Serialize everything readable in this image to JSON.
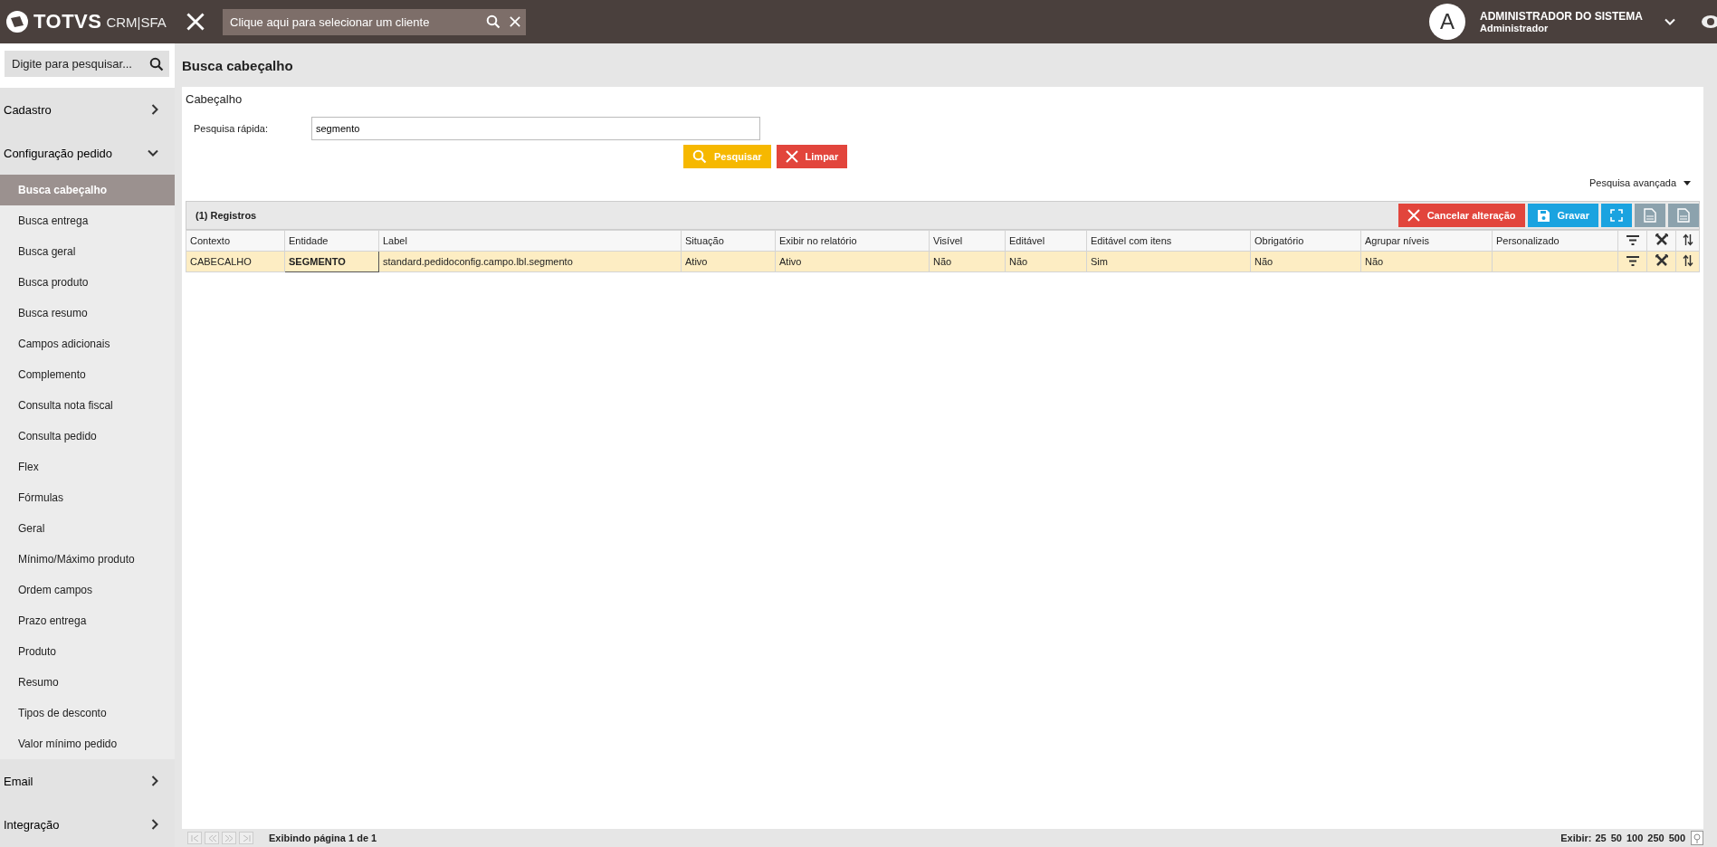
{
  "topbar": {
    "brand": "TOTVS",
    "product": "CRM|SFA",
    "client_search": {
      "placeholder": "Clique aqui para selecionar um cliente"
    },
    "user": {
      "initial": "A",
      "name": "ADMINISTRADOR DO SISTEMA",
      "role": "Administrador"
    }
  },
  "sidebar": {
    "search": {
      "placeholder": "Digite para pesquisar..."
    },
    "items": [
      {
        "label": "Cadastro",
        "expanded": false
      },
      {
        "label": "Configuração pedido",
        "expanded": true,
        "children": [
          {
            "label": "Busca cabeçalho",
            "selected": true
          },
          {
            "label": "Busca entrega",
            "selected": false
          },
          {
            "label": "Busca geral",
            "selected": false
          },
          {
            "label": "Busca produto",
            "selected": false
          },
          {
            "label": "Busca resumo",
            "selected": false
          },
          {
            "label": "Campos adicionais",
            "selected": false
          },
          {
            "label": "Complemento",
            "selected": false
          },
          {
            "label": "Consulta nota fiscal",
            "selected": false
          },
          {
            "label": "Consulta pedido",
            "selected": false
          },
          {
            "label": "Flex",
            "selected": false
          },
          {
            "label": "Fórmulas",
            "selected": false
          },
          {
            "label": "Geral",
            "selected": false
          },
          {
            "label": "Mínimo/Máximo produto",
            "selected": false
          },
          {
            "label": "Ordem campos",
            "selected": false
          },
          {
            "label": "Prazo entrega",
            "selected": false
          },
          {
            "label": "Produto",
            "selected": false
          },
          {
            "label": "Resumo",
            "selected": false
          },
          {
            "label": "Tipos de desconto",
            "selected": false
          },
          {
            "label": "Valor mínimo pedido",
            "selected": false
          }
        ]
      },
      {
        "label": "Email",
        "expanded": false
      },
      {
        "label": "Integração",
        "expanded": false
      }
    ]
  },
  "page": {
    "title": "Busca cabeçalho",
    "section": "Cabeçalho",
    "quick_search": {
      "label": "Pesquisa rápida:",
      "value": "segmento"
    },
    "buttons": [
      {
        "label": "Pesquisar",
        "kind": "search"
      },
      {
        "label": "Limpar",
        "kind": "clear"
      }
    ],
    "advanced": "Pesquisa avançada"
  },
  "table": {
    "title": "(1) Registros",
    "actions": [
      {
        "label": "Cancelar alteração",
        "kind": "cancel"
      },
      {
        "label": "Gravar",
        "kind": "save"
      }
    ],
    "columns": [
      "Contexto",
      "Entidade",
      "Label",
      "Situação",
      "Exibir no relatório",
      "Visível",
      "Editável",
      "Editável com itens",
      "Obrigatório",
      "Agrupar níveis",
      "Personalizado"
    ],
    "rows": [
      {
        "selected": true,
        "cells": [
          {
            "text": "CABECALHO",
            "focused": false
          },
          {
            "text": "SEGMENTO",
            "focused": true
          },
          {
            "text": "standard.pedidoconfig.campo.lbl.segmento",
            "focused": false
          },
          {
            "text": "Ativo",
            "focused": false
          },
          {
            "text": "Ativo",
            "focused": false
          },
          {
            "text": "Não",
            "focused": false
          },
          {
            "text": "Não",
            "focused": false
          },
          {
            "text": "Sim",
            "focused": false
          },
          {
            "text": "Não",
            "focused": false
          },
          {
            "text": "Não",
            "focused": false
          },
          {
            "text": "",
            "focused": false
          }
        ]
      }
    ]
  },
  "pager": {
    "status": "Exibindo página 1 de 1",
    "sizes_label": "Exibir:",
    "sizes": [
      "25",
      "50",
      "100",
      "250",
      "500"
    ]
  }
}
